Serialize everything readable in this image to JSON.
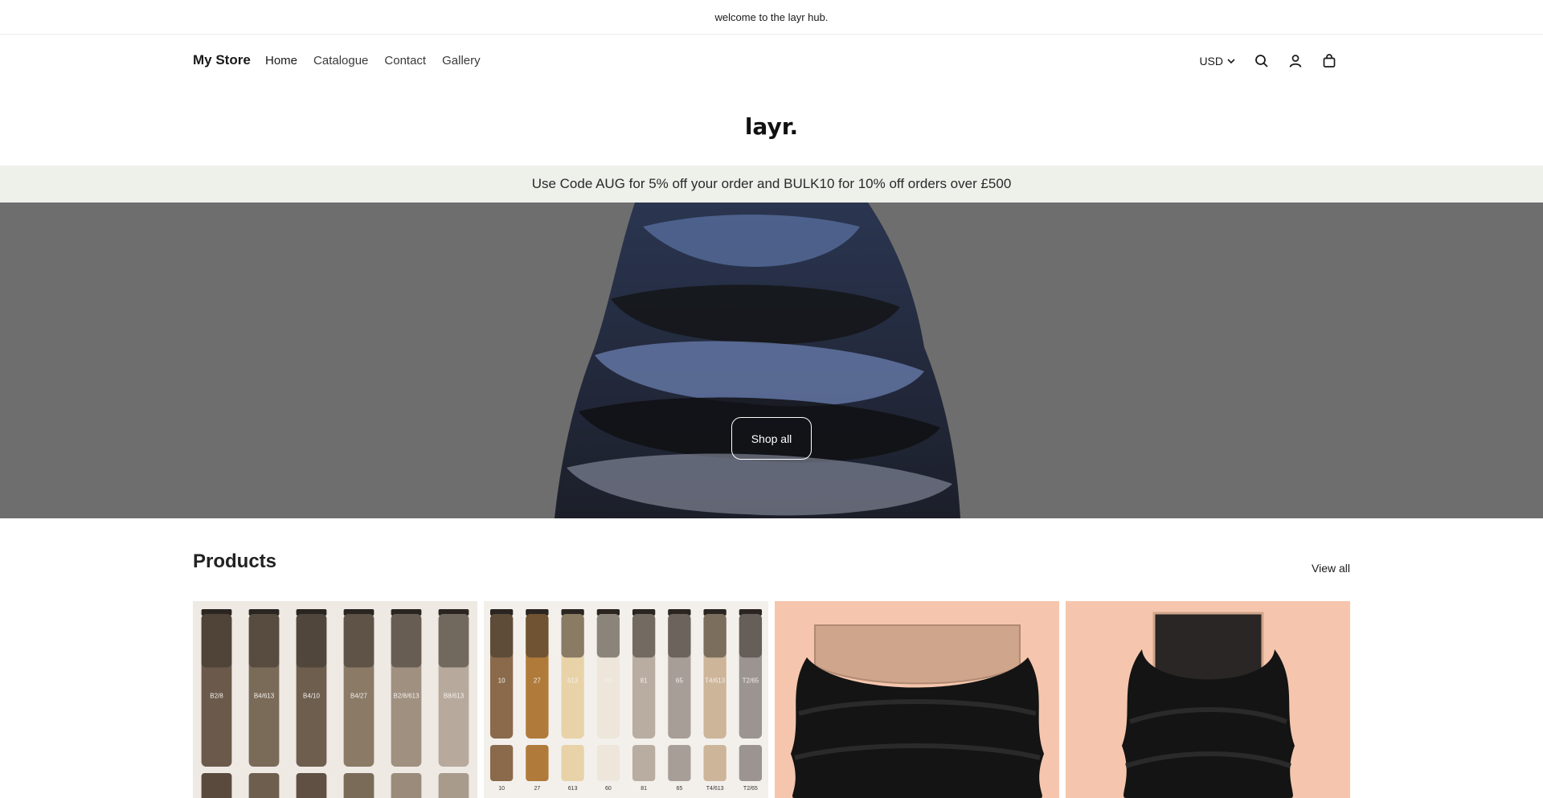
{
  "announcement": "welcome to the layr hub.",
  "header": {
    "brand": "My Store",
    "nav": [
      {
        "label": "Home"
      },
      {
        "label": "Catalogue"
      },
      {
        "label": "Contact"
      },
      {
        "label": "Gallery"
      }
    ],
    "currency": "USD"
  },
  "logo": "layr.",
  "promo": "Use Code AUG for 5% off your order and BULK10 for 10% off orders over £500",
  "hero": {
    "button": "Shop all"
  },
  "products": {
    "title": "Products",
    "view_all": "View all",
    "card1_labels": [
      "B2/8",
      "B4/613",
      "B4/10",
      "B4/27",
      "B2/8/613",
      "B8/613"
    ],
    "card2_labels": [
      "10",
      "27",
      "613",
      "60",
      "81",
      "65",
      "T4/613",
      "T2/65"
    ]
  },
  "colors": {
    "promo_bg": "#eef0ea",
    "hero_bg": "#6e6e6e",
    "card_peach": "#f5c6ad"
  }
}
